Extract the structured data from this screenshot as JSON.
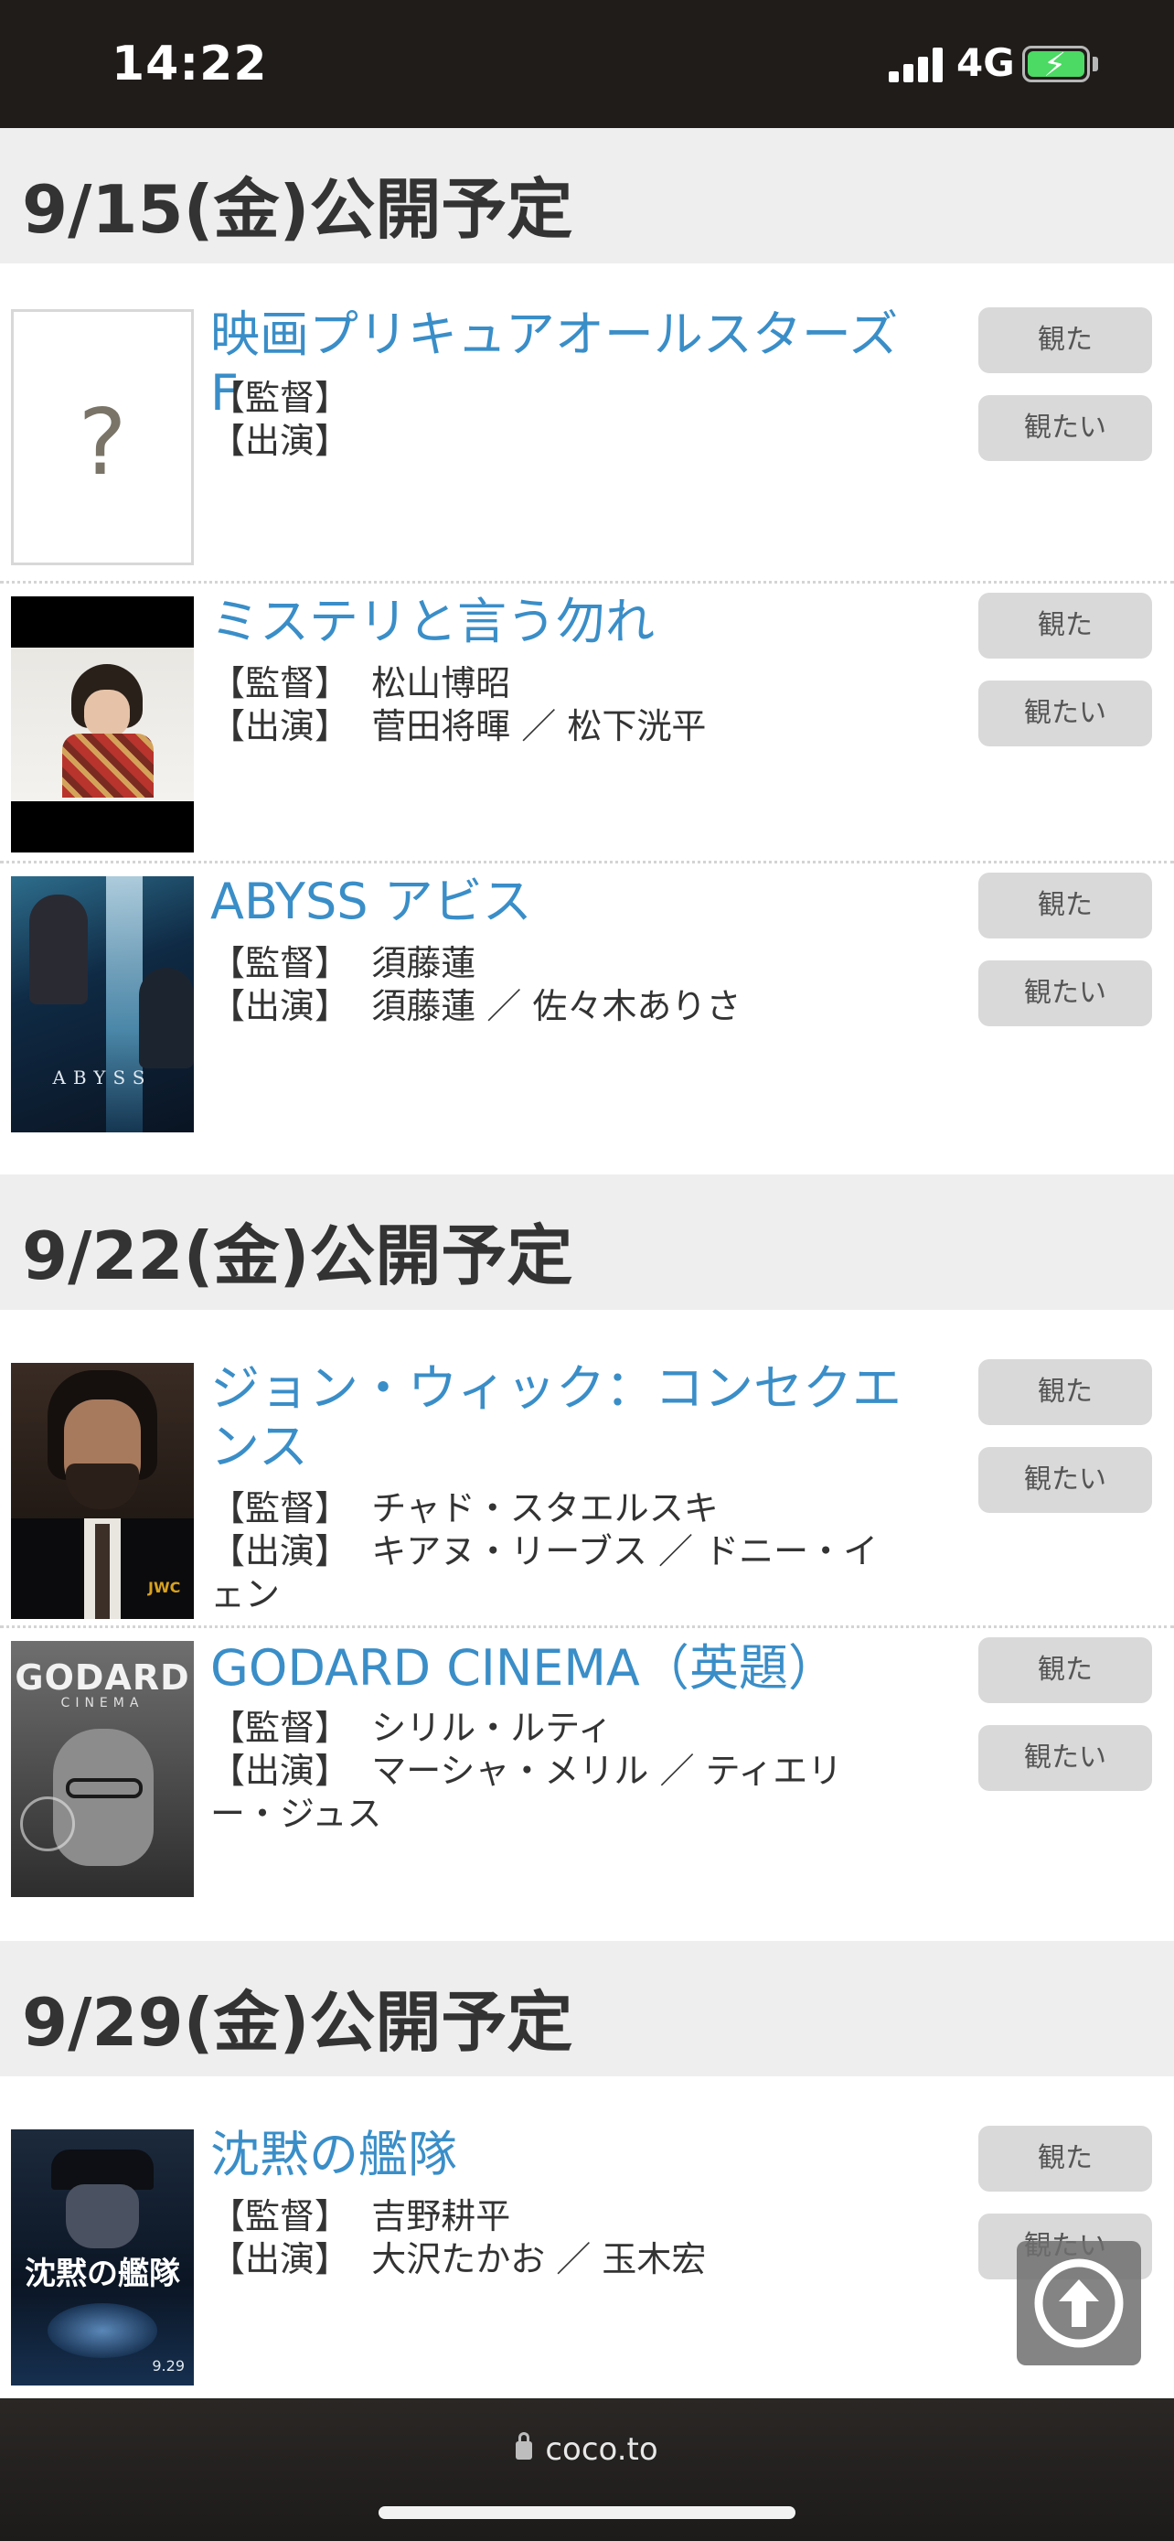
{
  "status_bar": {
    "time": "14:22",
    "network": "4G",
    "icons": [
      "signal-icon",
      "battery-charging-icon"
    ]
  },
  "labels": {
    "director": "【監督】",
    "cast": "【出演】",
    "watched_button": "観た",
    "want_button": "観たい"
  },
  "sections": [
    {
      "heading": "9/15(金)公開予定",
      "movies": [
        {
          "title": "映画プリキュアオールスターズF",
          "director": "",
          "cast": "",
          "poster_placeholder": "?"
        },
        {
          "title": "ミステリと言う勿れ",
          "director": "松山博昭",
          "cast": "菅田将暉 ／ 松下洸平"
        },
        {
          "title": "ABYSS アビス",
          "director": "須藤蓮",
          "cast": "須藤蓮 ／ 佐々木ありさ",
          "poster_text": "ABYSS"
        }
      ]
    },
    {
      "heading": "9/22(金)公開予定",
      "movies": [
        {
          "title": "ジョン・ウィック：コンセクエンス",
          "director": "チャド・スタエルスキ",
          "cast": "キアヌ・リーブス ／ ドニー・イェン",
          "poster_text": "JWC"
        },
        {
          "title": "GODARD CINEMA（英題）",
          "director": "シリル・ルティ",
          "cast": "マーシャ・メリル ／ ティエリー・ジュス",
          "poster_text": "GODARD",
          "poster_subtext": "CINEMA"
        }
      ]
    },
    {
      "heading": "9/29(金)公開予定",
      "movies": [
        {
          "title": "沈黙の艦隊",
          "director": "吉野耕平",
          "cast": "大沢たかお ／ 玉木宏",
          "poster_text": "沈黙の艦隊",
          "poster_date": "9.29"
        }
      ]
    }
  ],
  "bottom_bar": {
    "url": "coco.to"
  },
  "colors": {
    "title_link": "#3a8ec8",
    "section_bg": "#eeeeee",
    "button_bg": "#d9d9d9"
  }
}
